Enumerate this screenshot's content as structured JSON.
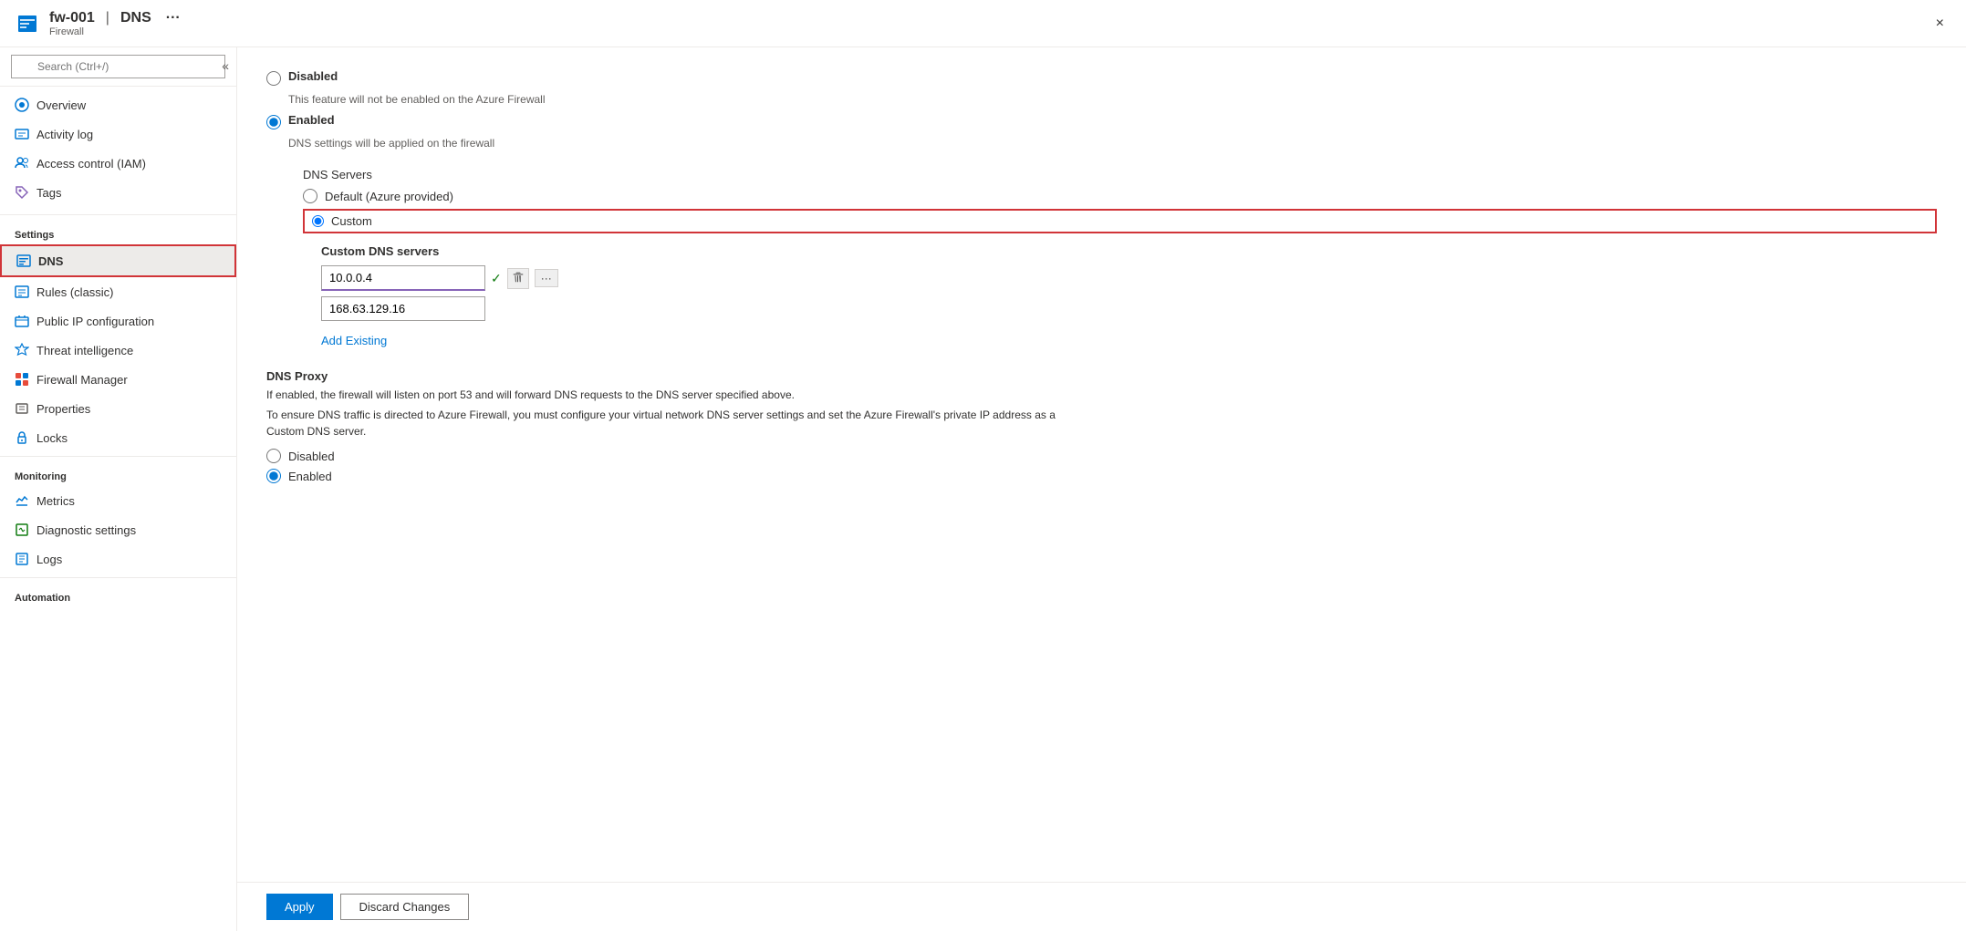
{
  "header": {
    "resource_name": "fw-001",
    "separator": "|",
    "page_title": "DNS",
    "resource_type": "Firewall",
    "ellipsis": "···",
    "close_label": "×"
  },
  "sidebar": {
    "search_placeholder": "Search (Ctrl+/)",
    "collapse_icon": "«",
    "nav_items": [
      {
        "id": "overview",
        "label": "Overview",
        "icon": "overview"
      },
      {
        "id": "activity-log",
        "label": "Activity log",
        "icon": "activity"
      },
      {
        "id": "access-control",
        "label": "Access control (IAM)",
        "icon": "access"
      },
      {
        "id": "tags",
        "label": "Tags",
        "icon": "tags"
      }
    ],
    "settings_header": "Settings",
    "settings_items": [
      {
        "id": "dns",
        "label": "DNS",
        "icon": "dns",
        "active": true
      },
      {
        "id": "rules",
        "label": "Rules (classic)",
        "icon": "rules"
      },
      {
        "id": "public-ip",
        "label": "Public IP configuration",
        "icon": "public-ip"
      },
      {
        "id": "threat-intel",
        "label": "Threat intelligence",
        "icon": "threat"
      },
      {
        "id": "firewall-manager",
        "label": "Firewall Manager",
        "icon": "firewall-mgr"
      },
      {
        "id": "properties",
        "label": "Properties",
        "icon": "properties"
      },
      {
        "id": "locks",
        "label": "Locks",
        "icon": "locks"
      }
    ],
    "monitoring_header": "Monitoring",
    "monitoring_items": [
      {
        "id": "metrics",
        "label": "Metrics",
        "icon": "metrics"
      },
      {
        "id": "diagnostic",
        "label": "Diagnostic settings",
        "icon": "diagnostic"
      },
      {
        "id": "logs",
        "label": "Logs",
        "icon": "logs"
      }
    ],
    "automation_header": "Automation"
  },
  "content": {
    "dns_mode": {
      "disabled_label": "Disabled",
      "disabled_desc": "This feature will not be enabled on the Azure Firewall",
      "enabled_label": "Enabled",
      "enabled_desc": "DNS settings will be applied on the firewall",
      "selected": "enabled"
    },
    "dns_servers": {
      "section_label": "DNS Servers",
      "default_label": "Default (Azure provided)",
      "custom_label": "Custom",
      "selected": "custom",
      "custom_dns_section_label": "Custom DNS servers",
      "server1_value": "10.0.0.4",
      "server2_value": "168.63.129.16",
      "add_existing_label": "Add Existing"
    },
    "dns_proxy": {
      "title": "DNS Proxy",
      "desc1": "If enabled, the firewall will listen on port 53 and will forward DNS requests to the DNS server specified above.",
      "desc2": "To ensure DNS traffic is directed to Azure Firewall, you must configure your virtual network DNS server settings and set the Azure Firewall's private IP address as a Custom DNS server.",
      "disabled_label": "Disabled",
      "enabled_label": "Enabled",
      "selected": "enabled"
    }
  },
  "footer": {
    "apply_label": "Apply",
    "discard_label": "Discard Changes"
  }
}
